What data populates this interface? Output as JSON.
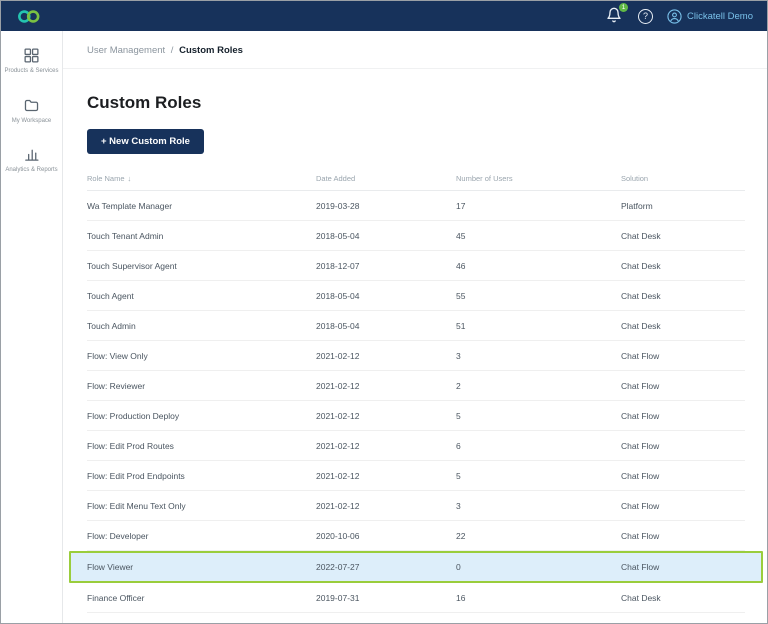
{
  "topbar": {
    "notification_count": "1",
    "help_label": "?",
    "user_label": "Clickatell Demo"
  },
  "sidebar": {
    "items": [
      {
        "label": "Products & Services",
        "icon": "grid-icon"
      },
      {
        "label": "My Workspace",
        "icon": "folder-icon"
      },
      {
        "label": "Analytics & Reports",
        "icon": "bar-chart-icon"
      }
    ]
  },
  "breadcrumb": {
    "parent": "User Management",
    "separator": "/",
    "current": "Custom Roles"
  },
  "page": {
    "title": "Custom Roles",
    "new_role_button": "+ New Custom Role"
  },
  "table": {
    "columns": [
      "Role Name",
      "Date Added",
      "Number of Users",
      "Solution"
    ],
    "sort_icon": "↓",
    "sort_column_index": 0,
    "highlight_index": 12,
    "rows": [
      {
        "name": "Wa Template Manager",
        "date": "2019-03-28",
        "users": "17",
        "solution": "Platform"
      },
      {
        "name": "Touch Tenant Admin",
        "date": "2018-05-04",
        "users": "45",
        "solution": "Chat Desk"
      },
      {
        "name": "Touch Supervisor Agent",
        "date": "2018-12-07",
        "users": "46",
        "solution": "Chat Desk"
      },
      {
        "name": "Touch Agent",
        "date": "2018-05-04",
        "users": "55",
        "solution": "Chat Desk"
      },
      {
        "name": "Touch Admin",
        "date": "2018-05-04",
        "users": "51",
        "solution": "Chat Desk"
      },
      {
        "name": "Flow: View Only",
        "date": "2021-02-12",
        "users": "3",
        "solution": "Chat Flow"
      },
      {
        "name": "Flow: Reviewer",
        "date": "2021-02-12",
        "users": "2",
        "solution": "Chat Flow"
      },
      {
        "name": "Flow: Production Deploy",
        "date": "2021-02-12",
        "users": "5",
        "solution": "Chat Flow"
      },
      {
        "name": "Flow: Edit Prod Routes",
        "date": "2021-02-12",
        "users": "6",
        "solution": "Chat Flow"
      },
      {
        "name": "Flow: Edit Prod Endpoints",
        "date": "2021-02-12",
        "users": "5",
        "solution": "Chat Flow"
      },
      {
        "name": "Flow: Edit Menu Text Only",
        "date": "2021-02-12",
        "users": "3",
        "solution": "Chat Flow"
      },
      {
        "name": "Flow: Developer",
        "date": "2020-10-06",
        "users": "22",
        "solution": "Chat Flow"
      },
      {
        "name": "Flow Viewer",
        "date": "2022-07-27",
        "users": "0",
        "solution": "Chat Flow"
      },
      {
        "name": "Finance Officer",
        "date": "2019-07-31",
        "users": "16",
        "solution": "Chat Desk"
      }
    ]
  },
  "colors": {
    "navy": "#17325b",
    "highlight_border": "#9acd3c",
    "highlight_bg": "#ddeefa",
    "link_blue": "#79c1ea",
    "badge_green": "#61b946"
  }
}
